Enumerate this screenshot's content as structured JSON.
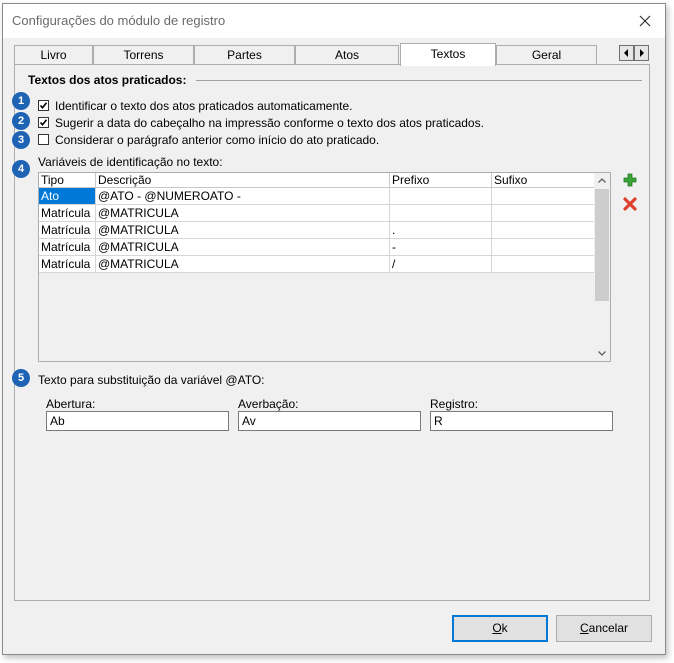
{
  "window": {
    "title": "Configurações do módulo de registro"
  },
  "tabs": [
    {
      "label": "Livro"
    },
    {
      "label": "Torrens"
    },
    {
      "label": "Partes"
    },
    {
      "label": "Atos"
    },
    {
      "label": "Textos"
    },
    {
      "label": "Geral"
    }
  ],
  "active_tab": "Textos",
  "section_title": "Textos dos atos praticados:",
  "badges": [
    "1",
    "2",
    "3",
    "4",
    "5"
  ],
  "options": [
    {
      "label": "Identificar o texto dos atos praticados automaticamente.",
      "checked": true
    },
    {
      "label": "Sugerir a data do cabeçalho na impressão conforme o texto dos atos praticados.",
      "checked": true
    },
    {
      "label": "Considerar o parágrafo anterior como início do ato praticado.",
      "checked": false
    }
  ],
  "variables": {
    "label": "Variáveis de identificação no texto:",
    "columns": [
      "Tipo",
      "Descrição",
      "Prefixo",
      "Sufixo"
    ],
    "rows": [
      [
        "Ato",
        "@ATO - @NUMEROATO -",
        "",
        ""
      ],
      [
        "Matrícula",
        "@MATRICULA",
        "",
        ""
      ],
      [
        "Matrícula",
        "@MATRICULA",
        ".",
        ""
      ],
      [
        "Matrícula",
        "@MATRICULA",
        "-",
        ""
      ],
      [
        "Matrícula",
        "@MATRICULA",
        "/",
        ""
      ]
    ]
  },
  "substitution": {
    "label": "Texto para substituição da variável @ATO:",
    "fields": [
      {
        "label": "Abertura:",
        "value": "Ab"
      },
      {
        "label": "Averbação:",
        "value": "Av"
      },
      {
        "label": "Registro:",
        "value": "R"
      }
    ]
  },
  "buttons": {
    "ok_first": "O",
    "ok_rest": "k",
    "cancel_first": "C",
    "cancel_rest": "ancelar"
  },
  "icons": {
    "add": "plus-icon",
    "remove": "delete-x-icon",
    "close": "close-icon",
    "tab_left": "arrow-left-icon",
    "tab_right": "arrow-right-icon"
  },
  "colors": {
    "badge": "#1e63b4",
    "selection": "#0078d7",
    "add": "#3aa335",
    "remove": "#e04030"
  }
}
